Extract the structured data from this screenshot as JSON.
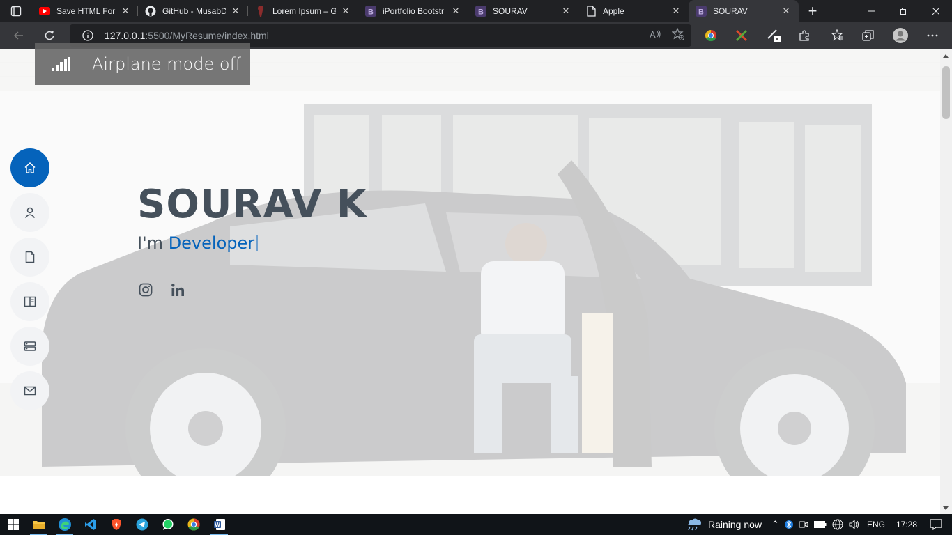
{
  "browser": {
    "tabs": [
      {
        "title": "Save HTML Form",
        "icon": "youtube-icon",
        "active": false
      },
      {
        "title": "GitHub - MusabD",
        "icon": "github-icon",
        "active": false
      },
      {
        "title": "Lorem Ipsum – Ge",
        "icon": "lorem-icon",
        "active": false
      },
      {
        "title": "iPortfolio Bootstr",
        "icon": "bootstrap-icon",
        "active": false
      },
      {
        "title": "SOURAV",
        "icon": "bootstrap-icon",
        "active": false
      },
      {
        "title": "Apple",
        "icon": "page-icon",
        "active": false
      },
      {
        "title": "SOURAV",
        "icon": "bootstrap-icon",
        "active": true
      }
    ],
    "url_host": "127.0.0.1",
    "url_path": ":5500/MyResume/index.html"
  },
  "toast": {
    "message": "Airplane mode off"
  },
  "hero": {
    "name": "SOURAV K",
    "tagline_prefix": "I'm ",
    "tagline_typed": "Developer"
  },
  "sidenav": {
    "items": [
      {
        "icon": "home-icon",
        "active": true
      },
      {
        "icon": "person-icon",
        "active": false
      },
      {
        "icon": "file-icon",
        "active": false
      },
      {
        "icon": "book-icon",
        "active": false
      },
      {
        "icon": "server-icon",
        "active": false
      },
      {
        "icon": "envelope-icon",
        "active": false
      }
    ]
  },
  "taskbar": {
    "weather": "Raining now",
    "language": "ENG",
    "time": "17:28"
  },
  "colors": {
    "accent": "#0563bb",
    "heading": "#45505b",
    "tab_strip": "#202124",
    "toolbar": "#35363a",
    "taskbar": "#101418"
  }
}
